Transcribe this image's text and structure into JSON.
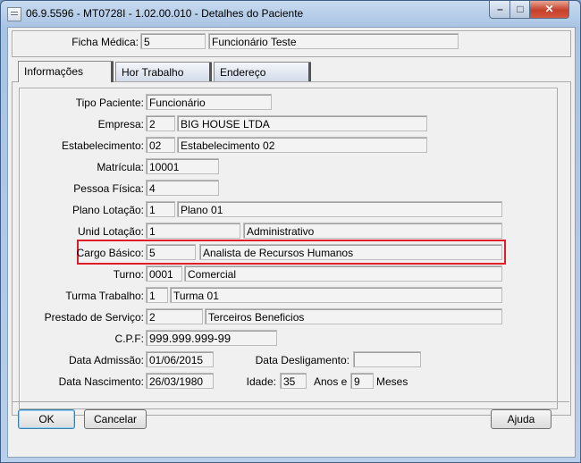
{
  "window": {
    "title": "06.9.5596 - MT0728I - 1.02.00.010 - Detalhes do Paciente",
    "controls": {
      "minimize": "–",
      "maximize": "□",
      "close": "✕"
    }
  },
  "header": {
    "ficha_label": "Ficha Médica:",
    "ficha_code": "5",
    "ficha_name": "Funcionário Teste"
  },
  "tabs": [
    {
      "label": "Informações",
      "active": true
    },
    {
      "label": "Hor Trabalho",
      "active": false
    },
    {
      "label": "Endereço",
      "active": false
    }
  ],
  "form": {
    "tipo_paciente": {
      "label": "Tipo Paciente:",
      "value": "Funcionário"
    },
    "empresa": {
      "label": "Empresa:",
      "code": "2",
      "name": "BIG HOUSE LTDA"
    },
    "estabelecimento": {
      "label": "Estabelecimento:",
      "code": "02",
      "name": "Estabelecimento 02"
    },
    "matricula": {
      "label": "Matrícula:",
      "value": "10001"
    },
    "pessoa_fisica": {
      "label": "Pessoa Física:",
      "value": "4"
    },
    "plano_lotacao": {
      "label": "Plano Lotação:",
      "code": "1",
      "name": "Plano 01"
    },
    "unid_lotacao": {
      "label": "Unid Lotação:",
      "code": "1",
      "name": "Administrativo"
    },
    "cargo_basico": {
      "label": "Cargo Básico:",
      "code": "5",
      "name": "Analista de Recursos Humanos"
    },
    "turno": {
      "label": "Turno:",
      "code": "0001",
      "name": "Comercial"
    },
    "turma_trabalho": {
      "label": "Turma Trabalho:",
      "code": "1",
      "name": "Turma 01"
    },
    "prestado_servico": {
      "label": "Prestado de Serviço:",
      "code": "2",
      "name": "Terceiros Beneficios"
    },
    "cpf": {
      "label": "C.P.F:",
      "value": "999.999.999-99"
    },
    "data_admissao": {
      "label": "Data Admissão:",
      "value": "01/06/2015"
    },
    "data_desligamento": {
      "label": "Data Desligamento:",
      "value": ""
    },
    "data_nascimento": {
      "label": "Data Nascimento:",
      "value": "26/03/1980"
    },
    "idade": {
      "label": "Idade:",
      "anos": "35",
      "anos_label": "Anos e",
      "meses": "9",
      "meses_label": "Meses"
    }
  },
  "buttons": {
    "ok": "OK",
    "cancel": "Cancelar",
    "help": "Ajuda"
  },
  "colors": {
    "highlight": "#e11d2a",
    "titlebar": "#b9cfea",
    "close": "#c6402a"
  }
}
